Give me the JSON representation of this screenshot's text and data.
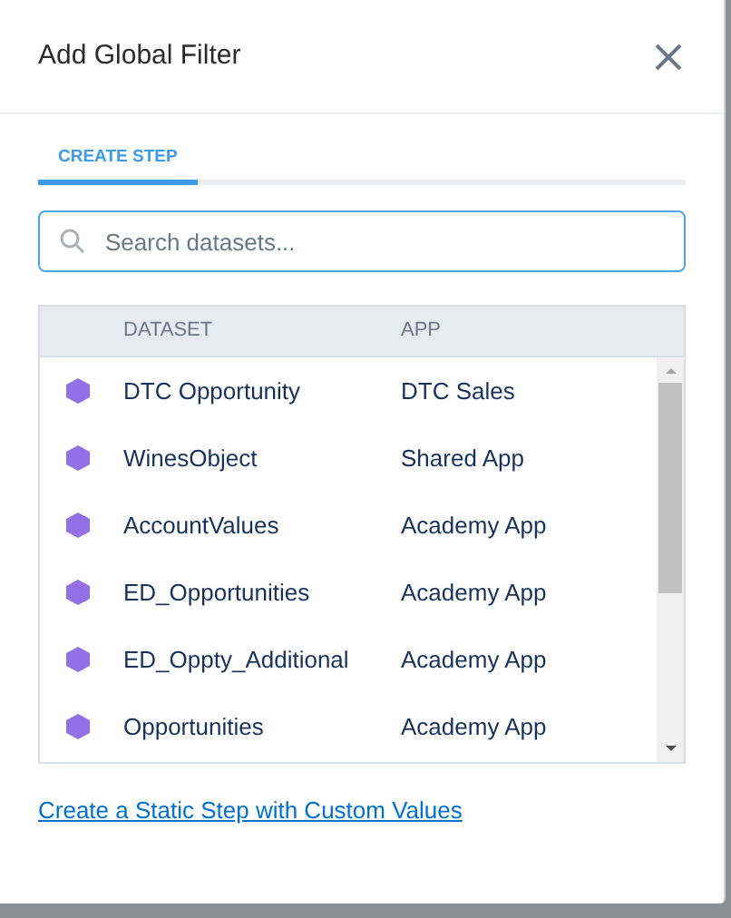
{
  "dialog": {
    "title": "Add Global Filter"
  },
  "tabs": [
    {
      "label": "CREATE STEP",
      "selected": true
    }
  ],
  "search": {
    "placeholder": "Search datasets..."
  },
  "table": {
    "columns": [
      "DATASET",
      "APP"
    ],
    "rows": [
      {
        "dataset": "DTC Opportunity",
        "app": "DTC Sales"
      },
      {
        "dataset": "WinesObject",
        "app": "Shared App"
      },
      {
        "dataset": "AccountValues",
        "app": "Academy App"
      },
      {
        "dataset": "ED_Opportunities",
        "app": "Academy App"
      },
      {
        "dataset": "ED_Oppty_Additional",
        "app": "Academy App"
      },
      {
        "dataset": "Opportunities",
        "app": "Academy App"
      }
    ]
  },
  "link": "Create a Static Step with Custom Values"
}
